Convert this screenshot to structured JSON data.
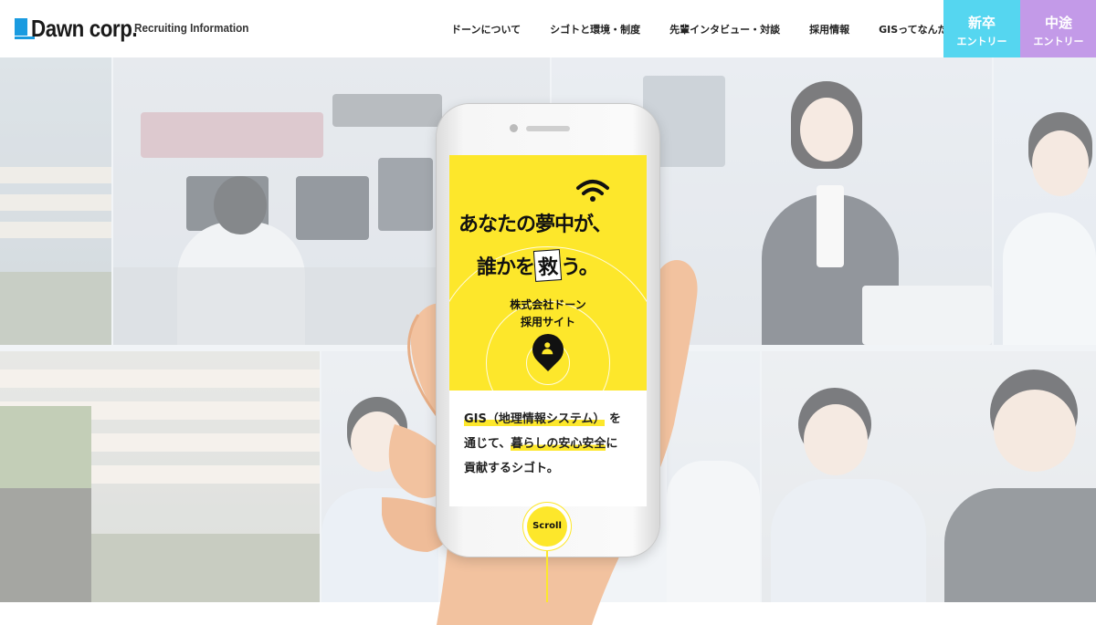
{
  "header": {
    "logo_text": "Dawn corp.",
    "logo_sub": "Recruiting Information",
    "nav": [
      "ドーンについて",
      "シゴトと環境・制度",
      "先輩インタビュー・対談",
      "採用情報",
      "GISってなんだ？"
    ],
    "entry_new": {
      "big": "新卒",
      "small": "エントリー"
    },
    "entry_mid": {
      "big": "中途",
      "small": "エントリー"
    }
  },
  "hero": {
    "catch_line1": "あなたの夢中が、",
    "catch_line2_pre": "誰かを",
    "catch_line2_kanji": "救",
    "catch_line2_post": "う。",
    "company_line1": "株式会社ドーン",
    "company_line2": "採用サイト",
    "copy_hl1": "GIS（地理情報システム）",
    "copy_t1": "を",
    "copy_t2": "通じて、",
    "copy_hl2": "暮らしの安心安全",
    "copy_t3": "に",
    "copy_t4": "貢献するシゴト。",
    "scroll_label": "Scroll"
  },
  "colors": {
    "accent_yellow": "#fde72b",
    "entry_new": "#55d6f0",
    "entry_mid": "#c39ae8",
    "logo_blue": "#1a9be0"
  }
}
